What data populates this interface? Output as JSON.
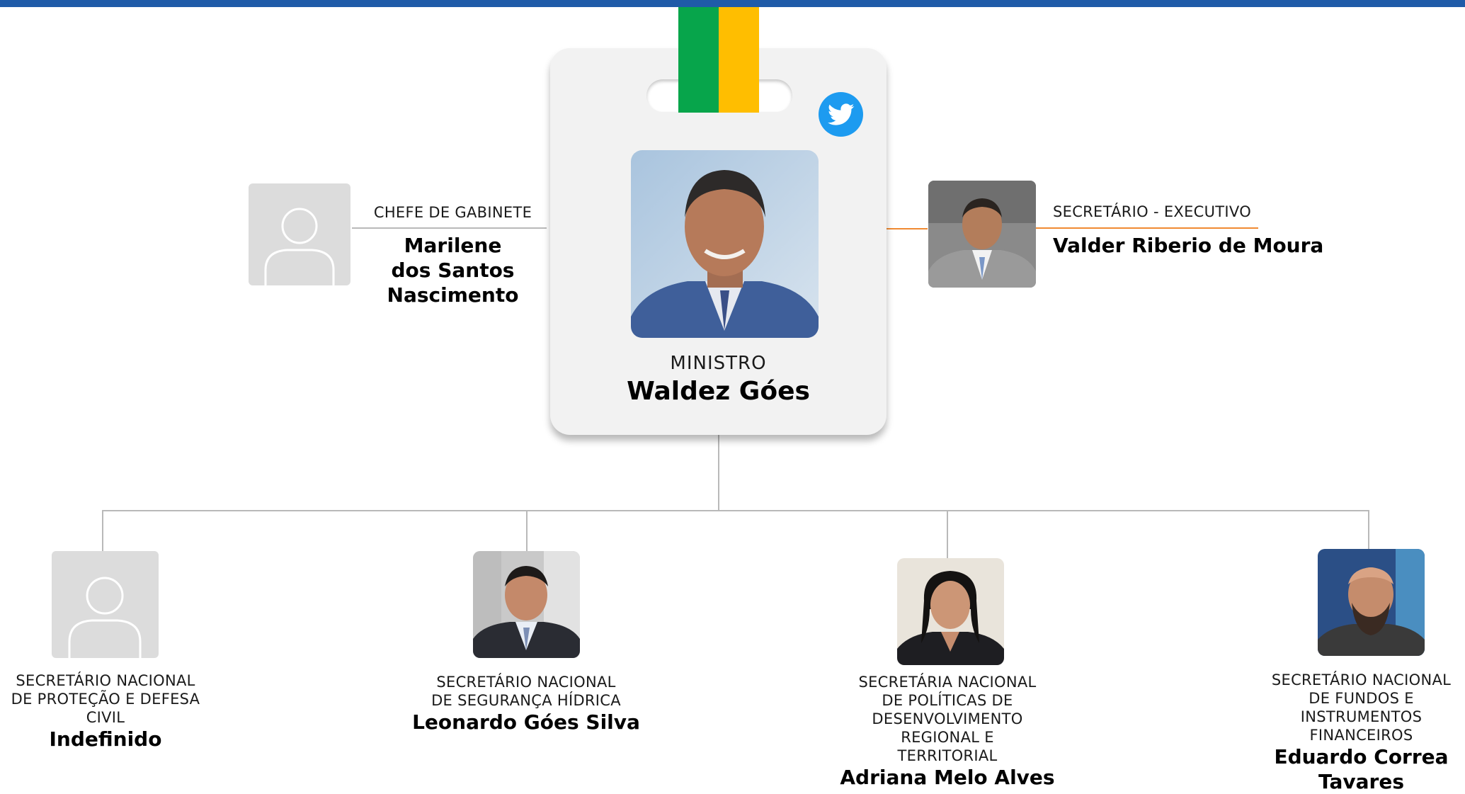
{
  "minister": {
    "role": "MINISTRO",
    "name": "Waldez Góes"
  },
  "chief_of_staff": {
    "role": "CHEFE DE GABINETE",
    "name": "Marilene dos Santos Nascimento"
  },
  "executive_secretary": {
    "role": "SECRETÁRIO - EXECUTIVO",
    "name": "Valder Riberio de Moura"
  },
  "secretaries": [
    {
      "role": "SECRETÁRIO NACIONAL DE PROTEÇÃO E DEFESA CIVIL",
      "name": "Indefinido"
    },
    {
      "role": "SECRETÁRIO NACIONAL DE SEGURANÇA HÍDRICA",
      "name": "Leonardo Góes Silva"
    },
    {
      "role": "SECRETÁRIA NACIONAL DE POLÍTICAS DE DESENVOLVIMENTO REGIONAL E TERRITORIAL",
      "name": "Adriana Melo Alves"
    },
    {
      "role": "SECRETÁRIO NACIONAL DE FUNDOS E INSTRUMENTOS FINANCEIROS",
      "name": "Eduardo Correa Tavares"
    }
  ],
  "colors": {
    "top_bar": "#1f5ba8",
    "ribbon_green": "#07a54b",
    "ribbon_yellow": "#ffbe00",
    "executive_connector": "#f08a32",
    "twitter": "#1d9bf0"
  },
  "icons": {
    "social": "twitter-icon",
    "placeholder": "user-placeholder-icon"
  }
}
